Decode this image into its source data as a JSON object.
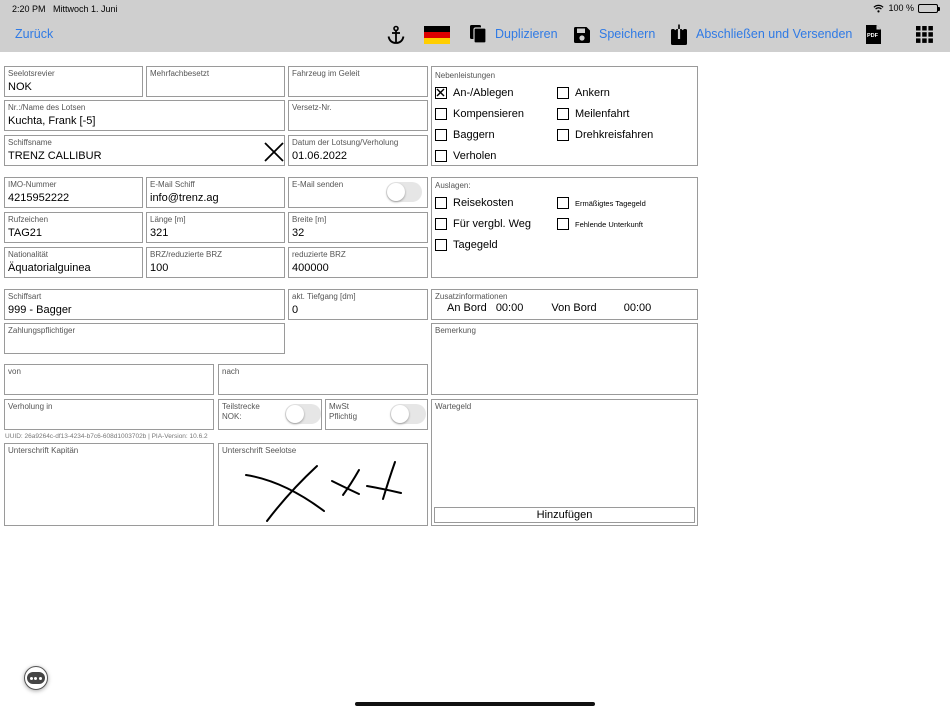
{
  "status_bar": {
    "time": "2:20 PM",
    "date": "Mittwoch 1. Juni",
    "battery": "100 %"
  },
  "toolbar": {
    "back_label": "Zurück",
    "duplicate_label": "Duplizieren",
    "save_label": "Speichern",
    "finish_label": "Abschließen und Versenden",
    "pdf_label": "PDF"
  },
  "colors": {
    "accent": "#2f7ae5",
    "navbar": "#cfcfcf",
    "border": "#9a9a9a"
  },
  "icons": [
    "anchor-icon",
    "german-flag-icon",
    "duplicate-icon",
    "save-icon",
    "upload-icon",
    "pdf-icon",
    "grid-icon"
  ],
  "form": {
    "seelotsrevier": {
      "label": "Seelotsrevier",
      "value": "NOK"
    },
    "mehrfachbesetzt": {
      "label": "Mehrfachbesetzt",
      "value": ""
    },
    "fahrzeug_im_geleit": {
      "label": "Fahrzeug im Geleit",
      "value": ""
    },
    "lotse": {
      "label": "Nr.:/Name des Lotsen",
      "value": "Kuchta, Frank [-5]"
    },
    "versetz_nr": {
      "label": "Versetz-Nr.",
      "value": ""
    },
    "schiffsname": {
      "label": "Schiffsname",
      "value": "TRENZ CALLIBUR"
    },
    "datum": {
      "label": "Datum der Lotsung/Verholung",
      "value": "01.06.2022"
    },
    "imo": {
      "label": "IMO-Nummer",
      "value": "4215952222"
    },
    "email_schiff": {
      "label": "E-Mail Schiff",
      "value": "info@trenz.ag"
    },
    "email_senden": {
      "label": "E-Mail senden",
      "on": false
    },
    "rufzeichen": {
      "label": "Rufzeichen",
      "value": "TAG21"
    },
    "laenge": {
      "label": "Länge [m]",
      "value": "321"
    },
    "breite": {
      "label": "Breite [m]",
      "value": "32"
    },
    "nationalitaet": {
      "label": "Nationalität",
      "value": "Äquatorialguinea"
    },
    "brz": {
      "label": "BRZ/reduzierte BRZ",
      "value": "100"
    },
    "reduzierte_brz": {
      "label": "reduzierte BRZ",
      "value": "400000"
    },
    "schiffsart": {
      "label": "Schiffsart",
      "value": "999 - Bagger"
    },
    "tiefgang": {
      "label": "akt. Tiefgang [dm]",
      "value": "0"
    },
    "zahlungspflichtiger": {
      "label": "Zahlungspflichtiger",
      "value": ""
    },
    "von": {
      "label": "von",
      "value": ""
    },
    "nach": {
      "label": "nach",
      "value": ""
    },
    "verholung_in": {
      "label": "Verholung in",
      "value": ""
    },
    "teilstrecke": {
      "label_line1": "Teilstrecke",
      "label_line2": "NOK:",
      "on": false
    },
    "mwst": {
      "label_line1": "MwSt",
      "label_line2": "Pflichtig",
      "on": false
    },
    "uuid_line": "UUID: 26a9264c-df13-4234-b7c6-608d1003702b | PIA-Version: 10.6.2",
    "unterschrift_kapitaen": {
      "label": "Unterschrift Kapitän"
    },
    "unterschrift_seelotse": {
      "label": "Unterschrift Seelotse"
    }
  },
  "nebenleistungen": {
    "label": "Nebenleistungen",
    "items": [
      {
        "label": "An-/Ablegen",
        "checked": true
      },
      {
        "label": "Ankern",
        "checked": false
      },
      {
        "label": "Kompensieren",
        "checked": false
      },
      {
        "label": "Meilenfahrt",
        "checked": false
      },
      {
        "label": "Baggern",
        "checked": false
      },
      {
        "label": "Drehkreisfahren",
        "checked": false
      },
      {
        "label": "Verholen",
        "checked": false
      }
    ]
  },
  "auslagen": {
    "label": "Auslagen:",
    "items": [
      {
        "label": "Reisekosten",
        "checked": false
      },
      {
        "label": "Ermäßigtes Tagegeld",
        "checked": false
      },
      {
        "label": "Für vergbl. Weg",
        "checked": false
      },
      {
        "label": "Fehlende Unterkunft",
        "checked": false
      },
      {
        "label": "Tagegeld",
        "checked": false
      }
    ]
  },
  "zusatzinformationen": {
    "label": "Zusatzinformationen",
    "an_bord_label": "An Bord",
    "an_bord_value": "00:00",
    "von_bord_label": "Von Bord",
    "von_bord_value": "00:00"
  },
  "bemerkung": {
    "label": "Bemerkung",
    "value": ""
  },
  "wartegeld": {
    "label": "Wartegeld",
    "add_label": "Hinzufügen"
  }
}
